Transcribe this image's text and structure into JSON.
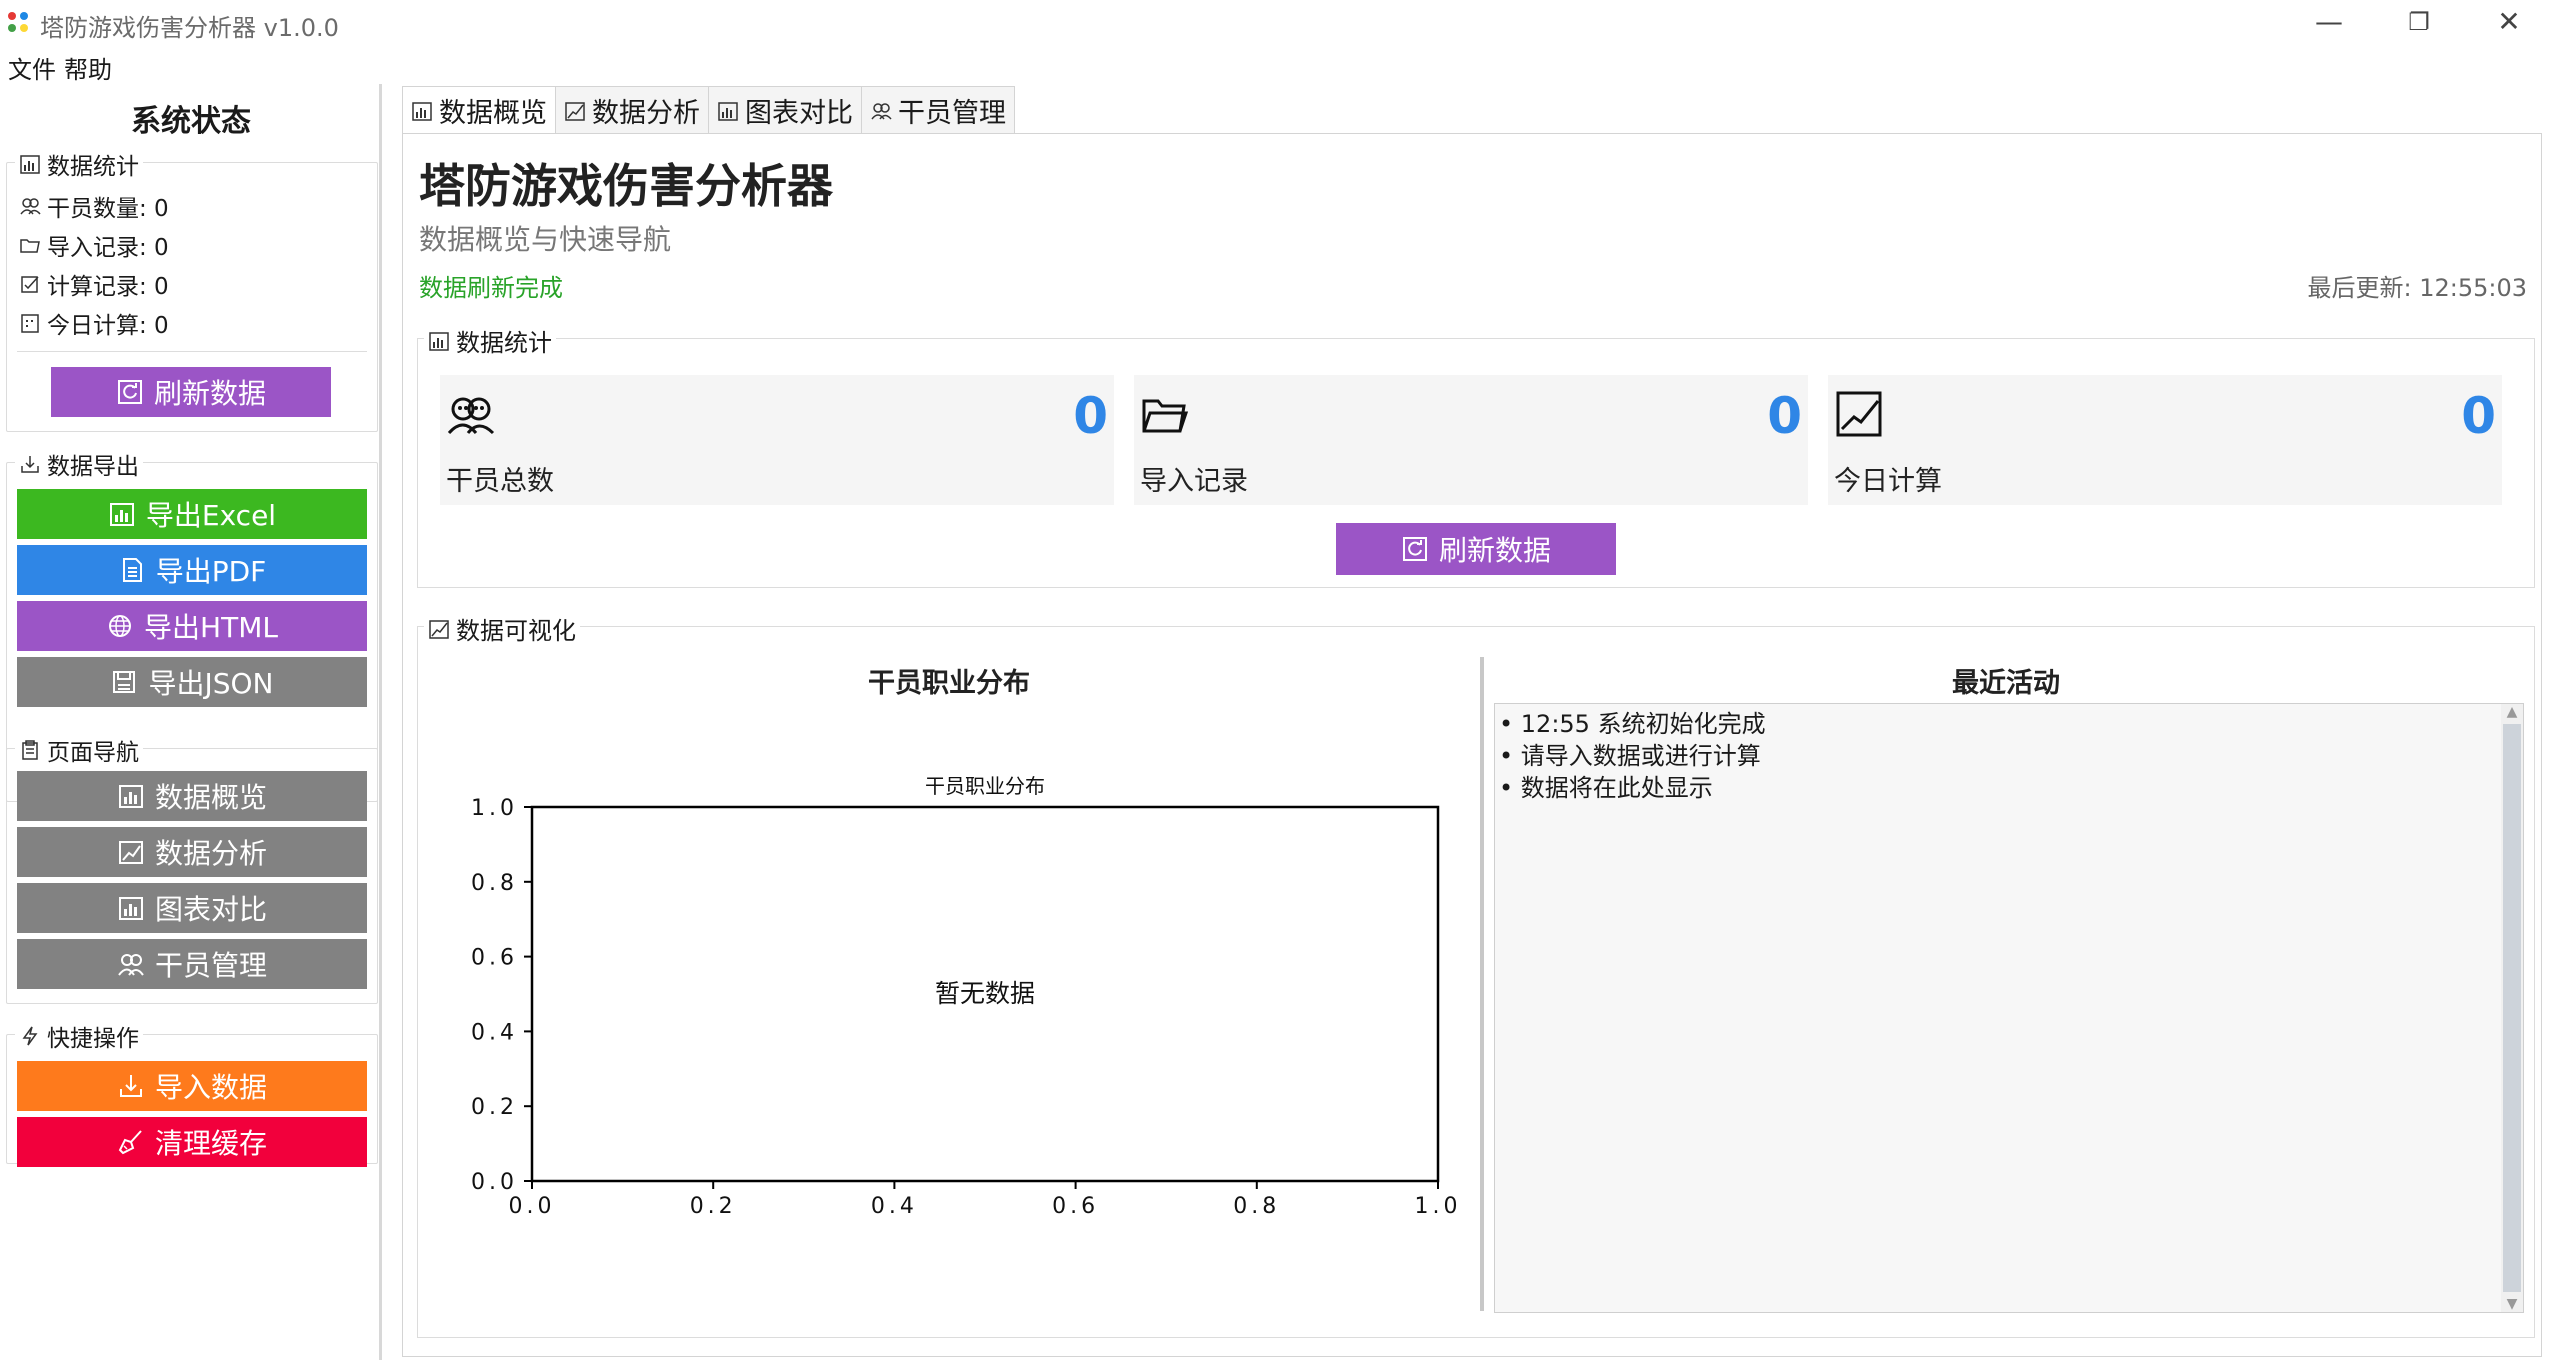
{
  "window": {
    "title": "塔防游戏伤害分析器 v1.0.0",
    "minimize": "—",
    "restore": "❐",
    "close": "✕"
  },
  "menu": [
    "文件",
    "帮助"
  ],
  "sidebar": {
    "title": "系统状态",
    "stats_group": {
      "label": "数据统计",
      "rows": [
        {
          "label": "干员数量: 0",
          "icon": "operators-icon"
        },
        {
          "label": "导入记录: 0",
          "icon": "folder-icon"
        },
        {
          "label": "计算记录: 0",
          "icon": "check-icon"
        },
        {
          "label": "今日计算: 0",
          "icon": "calendar-icon"
        }
      ],
      "refresh_label": "刷新数据"
    },
    "export_group": {
      "label": "数据导出",
      "buttons": [
        {
          "label": "导出Excel",
          "color": "#3cb820"
        },
        {
          "label": "导出PDF",
          "color": "#2f86e6"
        },
        {
          "label": "导出HTML",
          "color": "#9b55c6"
        },
        {
          "label": "导出JSON",
          "color": "#828282"
        }
      ]
    },
    "nav_group": {
      "label": "页面导航",
      "buttons": [
        {
          "label": "数据概览"
        },
        {
          "label": "数据分析"
        },
        {
          "label": "图表对比"
        },
        {
          "label": "干员管理"
        }
      ]
    },
    "quick_group": {
      "label": "快捷操作",
      "buttons": [
        {
          "label": "导入数据",
          "color": "#fe7a1c"
        },
        {
          "label": "清理缓存",
          "color": "#f2003c"
        }
      ]
    }
  },
  "tabs": [
    {
      "label": "数据概览",
      "active": true
    },
    {
      "label": "数据分析",
      "active": false
    },
    {
      "label": "图表对比",
      "active": false
    },
    {
      "label": "干员管理",
      "active": false
    }
  ],
  "main": {
    "title": "塔防游戏伤害分析器",
    "subtitle": "数据概览与快速导航",
    "status": "数据刷新完成",
    "last_update": "最后更新: 12:55:03",
    "stats_section": {
      "label": "数据统计",
      "cards": [
        {
          "label": "干员总数",
          "value": "0",
          "icon": "operators-icon"
        },
        {
          "label": "导入记录",
          "value": "0",
          "icon": "folder-icon"
        },
        {
          "label": "今日计算",
          "value": "0",
          "icon": "chart-line-icon"
        }
      ],
      "refresh_label": "刷新数据"
    },
    "viz_section": {
      "label": "数据可视化",
      "left_title": "干员职业分布",
      "right_title": "最近活动",
      "activities": [
        "• 12:55 系统初始化完成",
        "• 请导入数据或进行计算",
        "• 数据将在此处显示"
      ]
    }
  },
  "chart_data": {
    "type": "scatter",
    "title": "干员职业分布",
    "annotation": "暂无数据",
    "series": [],
    "xlim": [
      0.0,
      1.0
    ],
    "ylim": [
      0.0,
      1.0
    ],
    "xticks": [
      "0.0",
      "0.2",
      "0.4",
      "0.6",
      "0.8",
      "1.0"
    ],
    "yticks": [
      "0.0",
      "0.2",
      "0.4",
      "0.6",
      "0.8",
      "1.0"
    ],
    "xlabel": "",
    "ylabel": "",
    "grid": false
  }
}
